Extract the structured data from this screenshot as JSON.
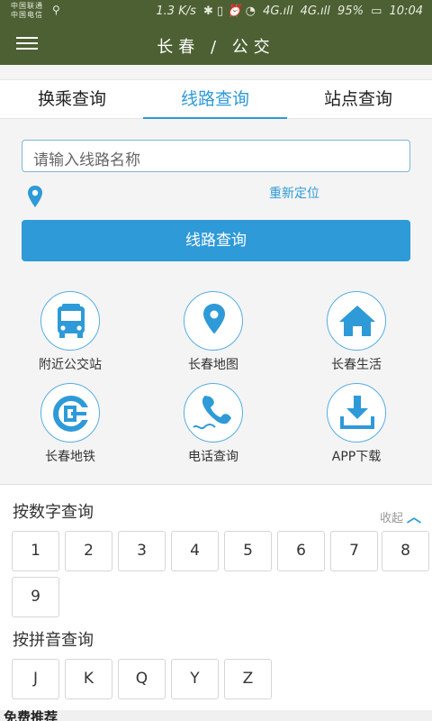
{
  "status": {
    "carrier_line1": "中国联通",
    "carrier_line2": "中国电信",
    "usb": "⚲",
    "speed": "1.3 K/s",
    "icons": "✱ ▯ ⏰ ◔",
    "signal1": "4G.ıll",
    "signal2": "4G.ıll",
    "battery": "95%",
    "time": "10:04"
  },
  "appbar": {
    "title": "长春 / 公交",
    "menu_icon": "hamburger-icon"
  },
  "tabs": [
    {
      "label": "换乘查询",
      "active": false
    },
    {
      "label": "线路查询",
      "active": true
    },
    {
      "label": "站点查询",
      "active": false
    }
  ],
  "form": {
    "input_placeholder": "请输入线路名称",
    "input_value": "",
    "relocate_label": "重新定位",
    "search_button": "线路查询"
  },
  "grid": [
    {
      "label": "附近公交站",
      "icon": "bus-icon"
    },
    {
      "label": "长春地图",
      "icon": "map-pin-icon"
    },
    {
      "label": "长春生活",
      "icon": "home-icon"
    },
    {
      "label": "长春地铁",
      "icon": "metro-icon"
    },
    {
      "label": "电话查询",
      "icon": "phone-icon"
    },
    {
      "label": "APP下载",
      "icon": "download-icon"
    }
  ],
  "number_section": {
    "title": "按数字查询",
    "collapse_label": "收起",
    "keys": [
      "1",
      "2",
      "3",
      "4",
      "5",
      "6",
      "7",
      "8",
      "9"
    ]
  },
  "pinyin_section": {
    "title": "按拼音查询",
    "keys": [
      "J",
      "K",
      "Q",
      "Y",
      "Z"
    ]
  },
  "footer": {
    "partial_title": "免费推荐"
  },
  "colors": {
    "appbar": "#4d6033",
    "accent": "#2e9ad8"
  }
}
